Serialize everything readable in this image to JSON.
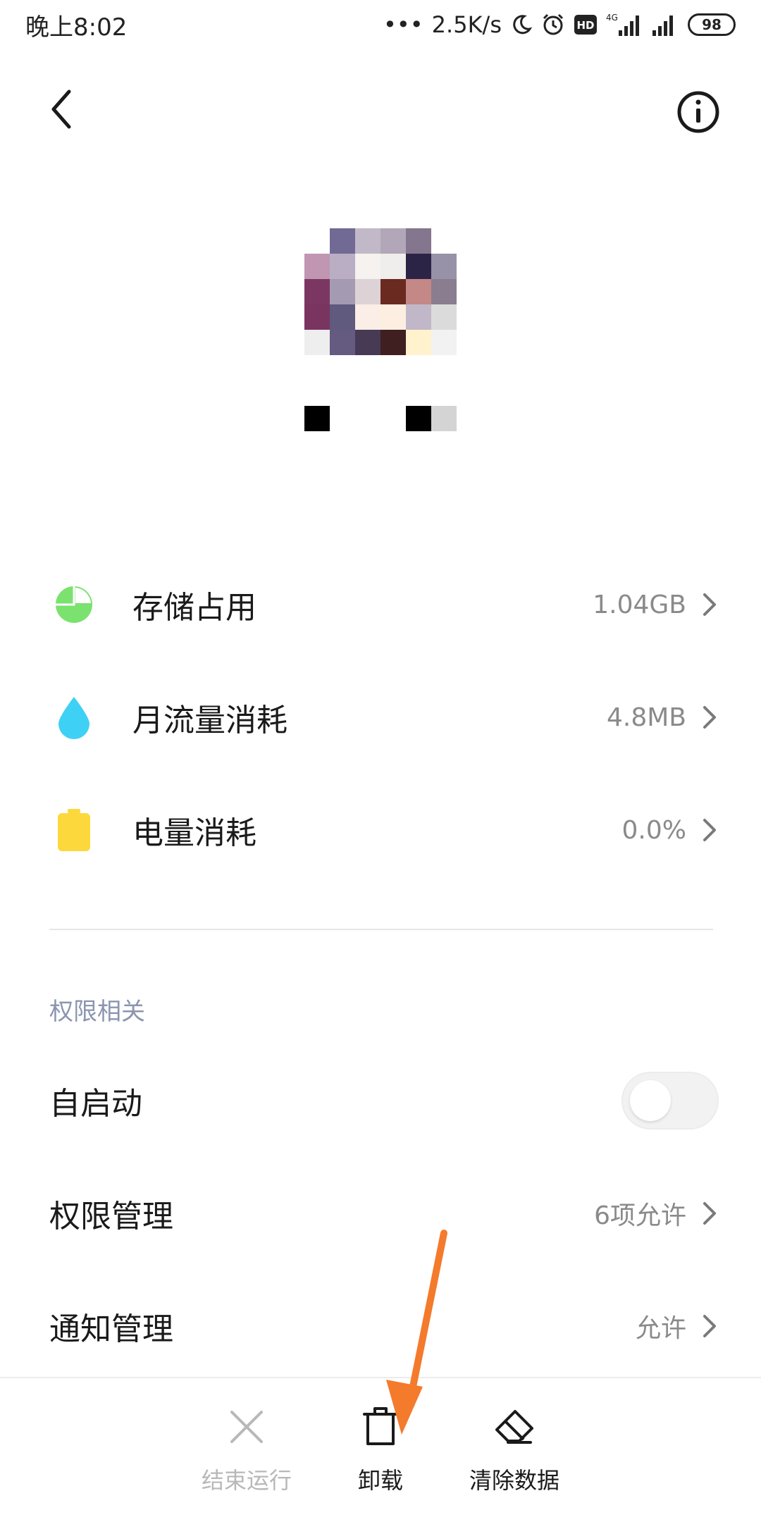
{
  "status_bar": {
    "time": "晚上8:02",
    "network_speed": "2.5K/s",
    "network_type": "4G",
    "hd_label": "HD",
    "battery": "98"
  },
  "header": {
    "back_icon": "back-arrow-icon",
    "info_icon": "info-icon"
  },
  "stats": [
    {
      "label": "存储占用",
      "value": "1.04GB",
      "icon": "pie-chart-icon",
      "color": "#7be26f"
    },
    {
      "label": "月流量消耗",
      "value": "4.8MB",
      "icon": "water-drop-icon",
      "color": "#3fd0f5"
    },
    {
      "label": "电量消耗",
      "value": "0.0%",
      "icon": "battery-icon",
      "color": "#fcd83c"
    }
  ],
  "permissions": {
    "section_title": "权限相关",
    "autostart": {
      "label": "自启动",
      "enabled": false
    },
    "permission_mgmt": {
      "label": "权限管理",
      "value": "6项允许"
    },
    "notification_mgmt": {
      "label": "通知管理",
      "value": "允许"
    }
  },
  "bottom_actions": [
    {
      "label": "结束运行",
      "icon": "close-icon",
      "disabled": true
    },
    {
      "label": "卸载",
      "icon": "trash-icon",
      "disabled": false
    },
    {
      "label": "清除数据",
      "icon": "eraser-icon",
      "disabled": false
    }
  ],
  "colors": {
    "accent_arrow": "#f47a2c",
    "secondary_text": "#8a8a8a",
    "section_title": "#8b95b0"
  }
}
